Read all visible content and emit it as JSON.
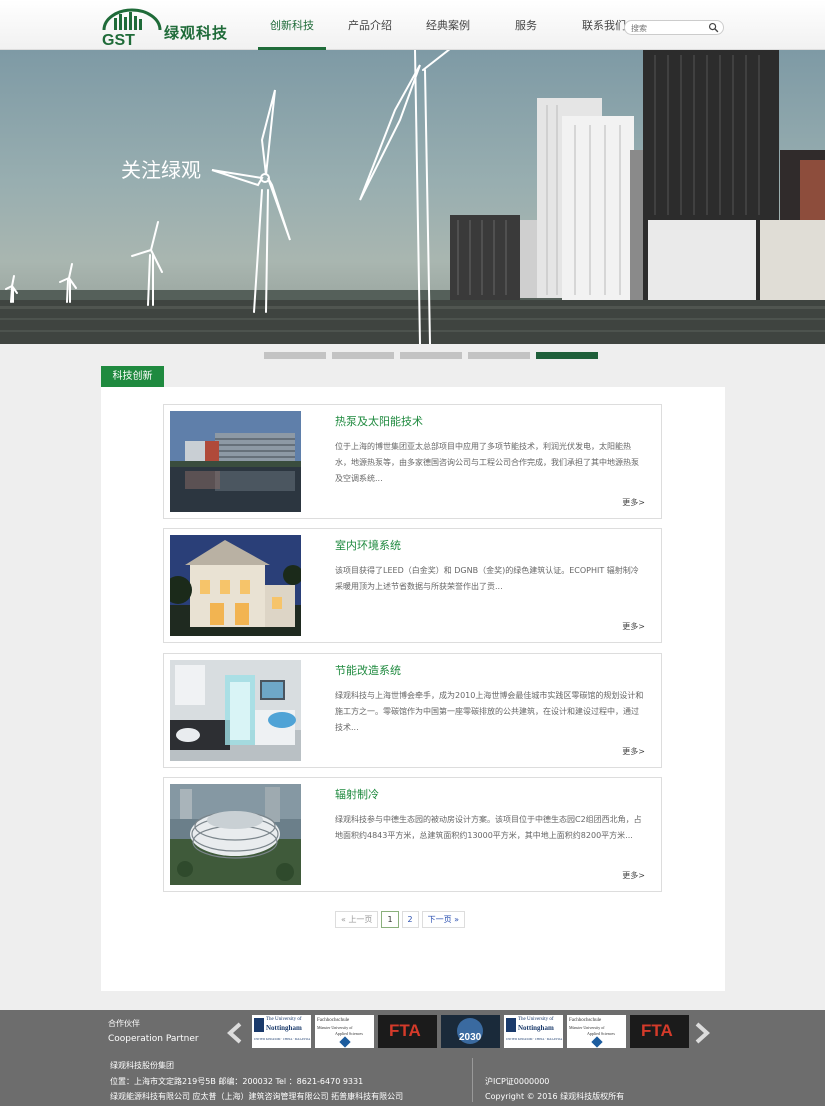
{
  "header": {
    "logo_letters": "GST",
    "logo_text": "绿观科技",
    "nav": [
      "创新科技",
      "产品介绍",
      "经典案例",
      "服务",
      "联系我们"
    ],
    "search_placeholder": "搜索"
  },
  "banner": {
    "title": "关注绿观",
    "slide_count": 5,
    "active_slide": 5
  },
  "section": {
    "tab": "科技创新"
  },
  "cards": [
    {
      "title": "热泵及太阳能技术",
      "desc": "位于上海的博世集团亚太总部项目中应用了多项节能技术，利润光伏发电，太阳能热水，地源热泵等，由多家德国咨询公司与工程公司合作完成，我们承担了其中地源热泵及空调系统...",
      "more": "更多>"
    },
    {
      "title": "室内环境系统",
      "desc": "该项目获得了LEED（白金奖）和 DGNB（金奖)的绿色建筑认证。ECOPHIT 辐射制冷采暖用顶为上述节省数据与所获荣誉作出了贡...",
      "more": "更多>"
    },
    {
      "title": "节能改造系统",
      "desc": "绿观科技与上海世博会牵手，成为2010上海世博会最佳城市实践区零碳馆的规划设计和施工方之一。零碳馆作为中国第一座零碳排放的公共建筑，在设计和建设过程中，通过技术...",
      "more": "更多>"
    },
    {
      "title": "辐射制冷",
      "desc": "绿观科技参与中德生态园的被动房设计方案。该项目位于中德生态园C2组团西北角，占地面积约4843平方米，总建筑面积约13000平方米，其中地上面积约8200平方米...",
      "more": "更多>"
    }
  ],
  "pagination": {
    "prev": "« 上一页",
    "pages": [
      "1",
      "2"
    ],
    "next": "下一页 »"
  },
  "footer": {
    "partner_title": "合作伙伴",
    "partner_sub": "Cooperation Partner",
    "partners": [
      {
        "line1": "The University of",
        "line2": "Nottingham",
        "line3": "UNITED KINGDOM · CHINA · MALAYSIA"
      },
      {
        "line1": "Fachhochschule",
        "line2": "Münster University of",
        "line3": "Applied Sciences"
      },
      {
        "line1": "FTA"
      },
      {
        "line1": "2030"
      },
      {
        "line1": "The University of",
        "line2": "Nottingham",
        "line3": "UNITED KINGDOM · CHINA · MALAYSIA"
      },
      {
        "line1": "Fachhochschule",
        "line2": "Münster University of",
        "line3": "Applied Sciences"
      },
      {
        "line1": "FTA"
      }
    ],
    "company": "绿观科技股份集团",
    "address": "位置：上海市文定路219号5B 邮编：200032 Tel ：8621-6470 9331",
    "affiliates": "绿观能源科技有限公司 应太普（上海）建筑咨询管理有限公司 拓普康科技有限公司",
    "icp": "沪ICP证0000000",
    "copyright": "Copyright © 2016 绿观科技版权所有"
  },
  "colors": {
    "brand_green": "#1f8a3f",
    "dark_green": "#1f6b39",
    "footer_bg": "#6d6d6d"
  }
}
